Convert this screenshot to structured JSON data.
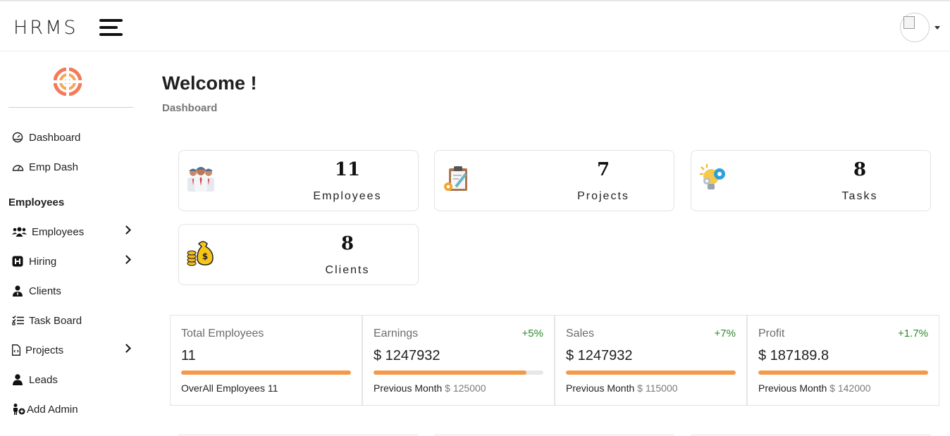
{
  "header": {
    "brand": "HRMS",
    "menu_icon": "hamburger-icon",
    "user_icon": "avatar",
    "dropdown_icon": "caret-down-icon"
  },
  "sidebar": {
    "logo_icon": "target-logo-icon",
    "items_top": [
      {
        "label": "Dashboard",
        "icon": "gauge-icon"
      },
      {
        "label": "Emp Dash",
        "icon": "speedometer-icon"
      }
    ],
    "section_title": "Employees",
    "items": [
      {
        "label": "Employees",
        "icon": "users-icon",
        "has_submenu": true
      },
      {
        "label": "Hiring",
        "icon": "h-square-icon",
        "has_submenu": true
      },
      {
        "label": "Clients",
        "icon": "user-tie-icon",
        "has_submenu": false
      },
      {
        "label": "Task Board",
        "icon": "list-check-icon",
        "has_submenu": false
      },
      {
        "label": "Projects",
        "icon": "file-code-icon",
        "has_submenu": true
      },
      {
        "label": "Leads",
        "icon": "user-icon",
        "has_submenu": false
      },
      {
        "label": "Add Admin",
        "icon": "user-plus-icon",
        "has_submenu": false
      }
    ]
  },
  "page": {
    "title": "Welcome !",
    "breadcrumb": "Dashboard"
  },
  "stats": [
    {
      "value": "11",
      "label": "Employees",
      "icon": "team-icon"
    },
    {
      "value": "7",
      "label": "Projects",
      "icon": "clipboard-icon"
    },
    {
      "value": "8",
      "label": "Tasks",
      "icon": "lightbulb-gear-icon"
    },
    {
      "value": "8",
      "label": "Clients",
      "icon": "money-bag-icon"
    }
  ],
  "metrics": [
    {
      "title": "Total Employees",
      "change": "",
      "value": "11",
      "progress": 1.0,
      "foot_label": "OverAll Employees 11",
      "foot_value": ""
    },
    {
      "title": "Earnings",
      "change": "+5%",
      "value": "$ 1247932",
      "progress": 0.9,
      "foot_label": "Previous Month",
      "foot_value": "$ 125000"
    },
    {
      "title": "Sales",
      "change": "+7%",
      "value": "$ 1247932",
      "progress": 1.0,
      "foot_label": "Previous Month",
      "foot_value": "$ 115000"
    },
    {
      "title": "Profit",
      "change": "+1.7%",
      "value": "$ 187189.8",
      "progress": 1.0,
      "foot_label": "Previous Month",
      "foot_value": "$ 142000"
    }
  ],
  "colors": {
    "accent": "#f4994a",
    "positive": "#2a8a2a",
    "muted": "#777777"
  }
}
